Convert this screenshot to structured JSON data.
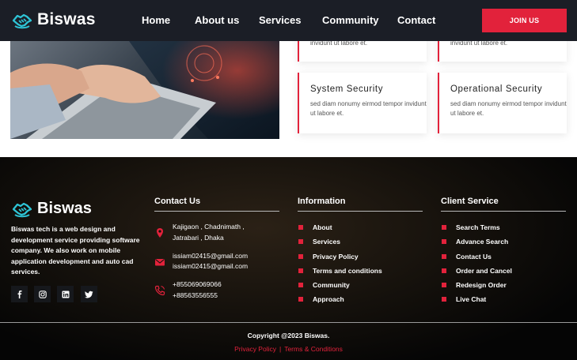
{
  "nav": {
    "brand": "Biswas",
    "links": [
      "Home",
      "About us",
      "Services",
      "Community",
      "Contact"
    ],
    "join": "JOIN US"
  },
  "cards": {
    "top_left_text": "invidunt ut labore et.",
    "top_right_text": "invidunt ut labore et.",
    "items": [
      {
        "title": "System Security",
        "text": "sed diam nonumy eirmod tempor invidunt ut labore et."
      },
      {
        "title": "Operational Security",
        "text": "sed diam nonumy eirmod tempor invidunt ut labore et."
      }
    ]
  },
  "footer": {
    "brand": "Biswas",
    "description": "Biswas tech is a web design and development service providing software company. We also work on mobile application development and auto cad services.",
    "contact": {
      "title": "Contact Us",
      "address": [
        "Kajigaon , Chadnimath ,",
        "Jatrabari , Dhaka"
      ],
      "emails": [
        "issiam02415@gmail.com",
        "issiam02415@gmail.com"
      ],
      "phones": [
        "+855069069066",
        "+88563556555"
      ]
    },
    "information": {
      "title": "Information",
      "items": [
        "About",
        "Services",
        "Privacy Policy",
        "Terms and conditions",
        "Community",
        "Approach"
      ]
    },
    "client": {
      "title": "Client Service",
      "items": [
        "Search Terms",
        "Advance Search",
        "Contact Us",
        "Order and Cancel",
        "Redesign Order",
        "Live Chat"
      ]
    },
    "copyright": "Copyright @2023 Biswas.",
    "privacy": "Privacy Policy",
    "terms": "Terms & Conditions"
  },
  "colors": {
    "accent": "#e2223b",
    "brand_icon": "#2ec4d6",
    "nav_bg": "#1b1e26"
  },
  "icons": [
    "handshake-logo-icon",
    "location-icon",
    "mail-icon",
    "phone-icon",
    "facebook-icon",
    "instagram-icon",
    "linkedin-icon",
    "twitter-icon"
  ]
}
